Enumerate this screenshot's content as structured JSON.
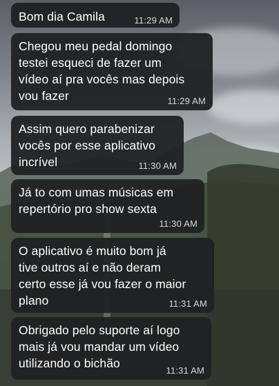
{
  "chat": {
    "messages": [
      {
        "text": "Bom dia Camila",
        "time": "11:29 AM"
      },
      {
        "text": "Chegou meu pedal domingo\ntestei esqueci de fazer um\nvídeo aí pra vocês mas depois\nvou fazer",
        "time": "11:29 AM"
      },
      {
        "text": "Assim quero parabenizar\nvocês por esse aplicativo\nincrível",
        "time": "11:30 AM"
      },
      {
        "text": "Já to com umas músicas em\nrepertório pro show sexta",
        "time": "11:30 AM"
      },
      {
        "text": "O aplicativo é muito bom já\ntive outros aí e não deram\ncerto esse já vou fazer o maior\nplano",
        "time": "11:31 AM"
      },
      {
        "text": "Obrigado pelo suporte aí logo\nmais já vou mandar um vídeo\nutilizando o bichão",
        "time": "11:31 AM"
      }
    ]
  },
  "colors": {
    "bubble": "#202123",
    "text": "#ffffff",
    "timestamp": "#d8d8d8"
  }
}
